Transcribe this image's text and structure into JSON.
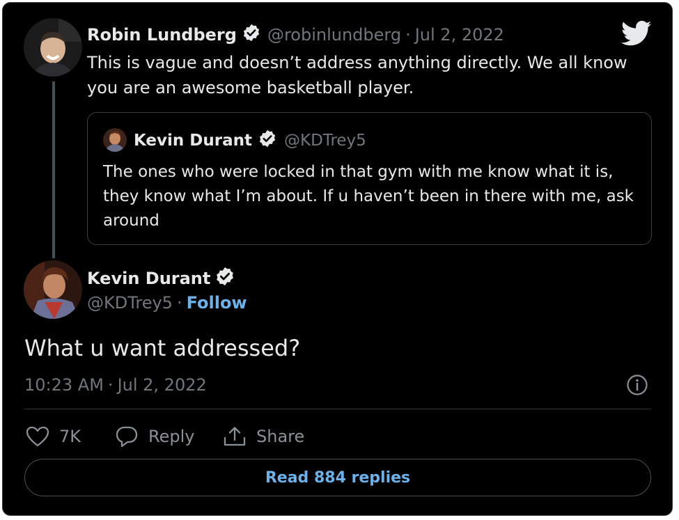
{
  "original_tweet": {
    "author_name": "Robin Lundberg",
    "handle": "@robinlundberg",
    "separator": "·",
    "date": "Jul 2, 2022",
    "text": "This is vague and doesn’t address anything directly. We all know you are an awesome basketball player."
  },
  "quoted_tweet": {
    "author_name": "Kevin Durant",
    "handle": "@KDTrey5",
    "text": "The ones who were locked in that gym with me know what it is, they know what I’m about. If u haven’t been in there with me, ask around"
  },
  "main_tweet": {
    "author_name": "Kevin Durant",
    "handle": "@KDTrey5",
    "separator": "·",
    "follow_label": "Follow",
    "text": "What u want addressed?",
    "time": "10:23 AM",
    "time_separator": "·",
    "date": "Jul 2, 2022"
  },
  "actions": {
    "like_count": "7K",
    "reply_label": "Reply",
    "share_label": "Share"
  },
  "read_replies_label": "Read 884 replies",
  "icons": {
    "brand": "twitter-bird-icon",
    "verified": "verified-badge-icon",
    "info": "info-icon",
    "like": "heart-icon",
    "reply": "speech-bubble-icon",
    "share": "share-upload-icon"
  },
  "colors": {
    "background": "#000000",
    "text": "#e7e9ea",
    "muted": "#71767b",
    "link": "#6cb2ea"
  }
}
